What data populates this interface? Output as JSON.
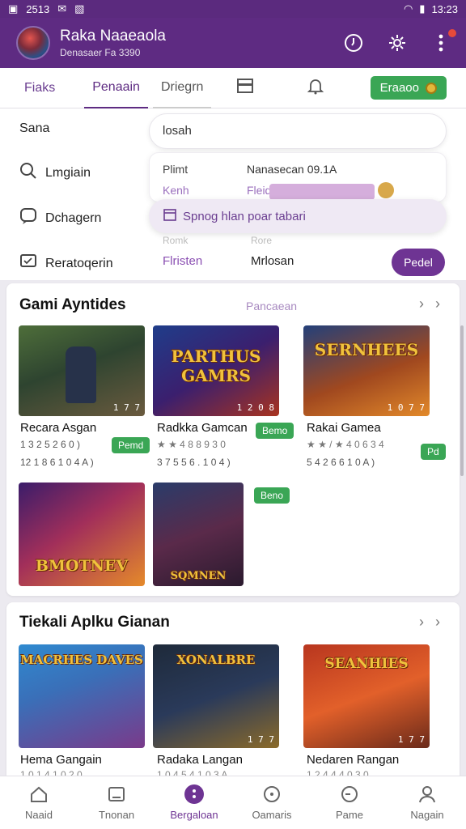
{
  "status_bar": {
    "left_text": "2513",
    "time": "13:23"
  },
  "header": {
    "title": "Raka Naaeaola",
    "subtitle": "Denasaer Fa 3390"
  },
  "tabs": [
    {
      "label": "Fiaks"
    },
    {
      "label": "Penaain"
    },
    {
      "label": "Driegrn"
    }
  ],
  "tab_action": {
    "label": "Eraaoo"
  },
  "drawer": {
    "heading": "Sana",
    "items": [
      {
        "label": "Lmgiain"
      },
      {
        "label": "Dchagern"
      },
      {
        "label": "Reratoqerin"
      }
    ]
  },
  "popover": {
    "search_value": "losah",
    "rows": [
      {
        "key": "Plimt",
        "value": "Nanasecan 09.1A"
      },
      {
        "key": "Kenh",
        "value": "Fleid"
      }
    ],
    "pill_label": "Spnog hlan poar tabari",
    "faint_left": "Romk",
    "faint_right": "Rore",
    "filter_label": "Flristen",
    "filter_value": "Mrlosan",
    "apply_label": "Pedel"
  },
  "section1": {
    "title": "Gami Ayntides",
    "link": "Pancaean",
    "games": [
      {
        "title": "Recara Asgan",
        "meta1": "1 3 2 5 2 6 0 )",
        "meta2": "12 1 8 6 1 0 4 A )",
        "badge": "Pemd",
        "tag": "1 7 7",
        "art": ""
      },
      {
        "title": "Radkka Gamcan",
        "meta1": "★ ★ 4 8 8 9 3 0",
        "meta2": "3 7 5 5 6 . 1 0 4 )",
        "badge": "Bemo",
        "tag": "1 2 0 8",
        "art": "PARTHUS GAMRS"
      },
      {
        "title": "Rakai Gamea",
        "meta1": "★ ★ / ★ 4 0 6 3 4",
        "meta2": "5 4 2 6 6 1 0 A )",
        "badge": "Pd",
        "tag": "1 0 7 7",
        "art": "SERNHEES"
      },
      {
        "title": "",
        "meta1": "",
        "meta2": "",
        "badge": "",
        "tag": "",
        "art": "BMOTNEV"
      },
      {
        "title": "",
        "meta1": "",
        "meta2": "",
        "badge": "Beno",
        "tag": "",
        "art": "SQMNEN"
      }
    ]
  },
  "section2": {
    "title": "Tiekali Aplku Gianan",
    "games": [
      {
        "title": "Hema Gangain",
        "meta": "1 0 1 4 1 0 2 0",
        "tag": "",
        "art": "MACRHES DAVES"
      },
      {
        "title": "Radaka Langan",
        "meta": "1 0 4 5 4 1 0 3 A",
        "tag": "1 7 7",
        "art": "XONALBRE"
      },
      {
        "title": "Nedaren Rangan",
        "meta": "1 2 4 4 4 0 3 0",
        "tag": "1 7 7",
        "art": "SEANHIES"
      }
    ]
  },
  "bottom_nav": [
    {
      "label": "Naaid"
    },
    {
      "label": "Tnonan"
    },
    {
      "label": "Bergaloan"
    },
    {
      "label": "Oamaris"
    },
    {
      "label": "Pame"
    },
    {
      "label": "Nagain"
    }
  ],
  "colors": {
    "primary": "#5e2b82",
    "green": "#3aa655",
    "accent_light": "#efe9f4"
  }
}
